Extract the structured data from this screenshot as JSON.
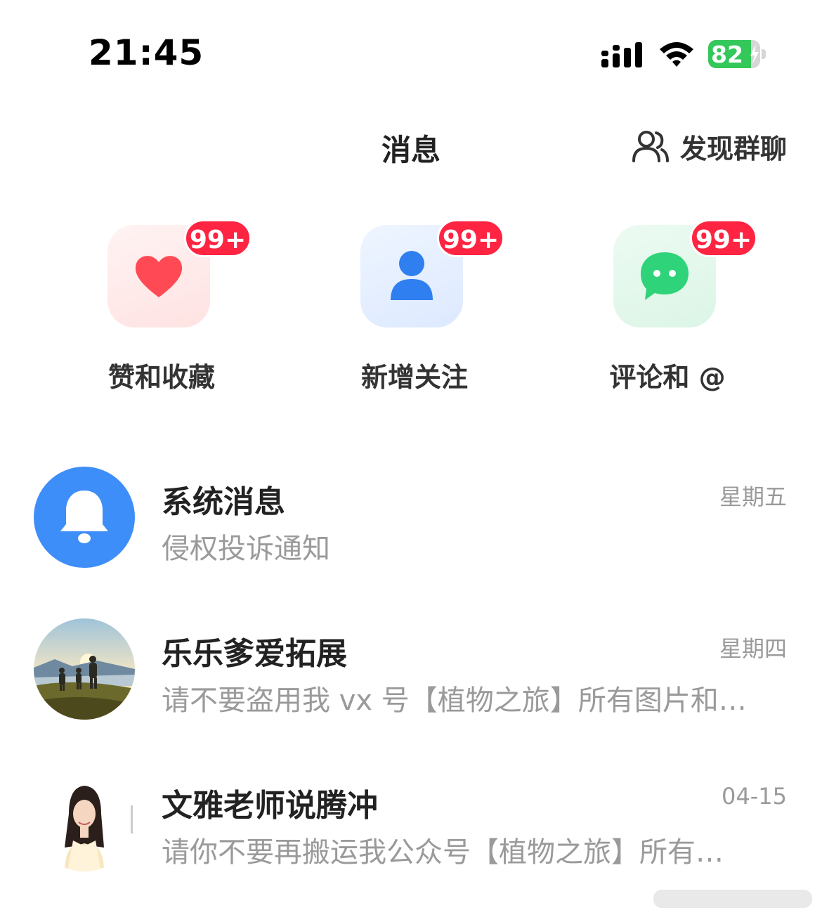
{
  "status_bar": {
    "time": "21:45",
    "battery": "82",
    "battery_level": 0.82
  },
  "header": {
    "title": "消息",
    "group_chat_label": "发现群聊"
  },
  "quick_actions": [
    {
      "label": "赞和收藏",
      "badge": "99+",
      "icon": "heart-icon",
      "tile_color": "#ffecec",
      "icon_color": "#ff4a55"
    },
    {
      "label": "新增关注",
      "badge": "99+",
      "icon": "person-icon",
      "tile_color": "#e6f0ff",
      "icon_color": "#2f7ff0"
    },
    {
      "label": "评论和 @",
      "badge": "99+",
      "icon": "chat-bubble-icon",
      "tile_color": "#e3f7ec",
      "icon_color": "#2fd37a"
    }
  ],
  "messages": [
    {
      "name": "系统消息",
      "preview": "侵权投诉通知",
      "time": "星期五",
      "avatar": "bell-icon"
    },
    {
      "name": "乐乐爹爱拓展",
      "preview": "请不要盗用我 vx 号【植物之旅】所有图片和…",
      "time": "星期四",
      "avatar": "landscape-photo"
    },
    {
      "name": "文雅老师说腾冲",
      "preview": "请你不要再搬运我公众号【植物之旅】所有…",
      "time": "04-15",
      "avatar": "portrait-photo"
    }
  ],
  "colors": {
    "badge": "#ff2442",
    "accent_blue": "#3d8ef8",
    "secondary_text": "#9a9a9a"
  }
}
